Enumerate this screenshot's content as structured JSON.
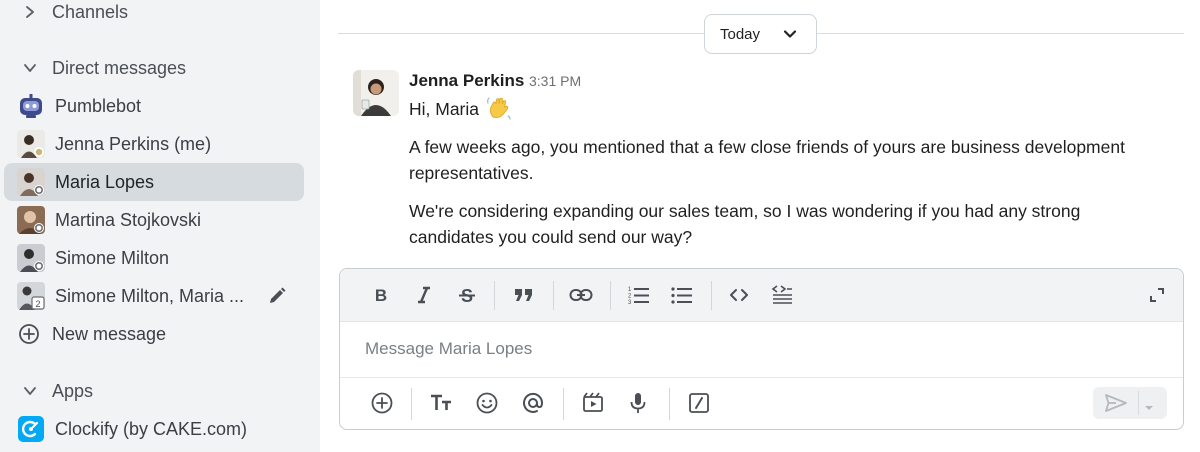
{
  "sidebar": {
    "channels_label": "Channels",
    "dm_label": "Direct messages",
    "dms": [
      {
        "name": "Pumblebot",
        "avatar": "bot-avatar-icon"
      },
      {
        "name": "Jenna Perkins (me)",
        "avatar": "user-avatar"
      },
      {
        "name": "Maria Lopes",
        "avatar": "user-avatar",
        "active": true
      },
      {
        "name": "Martina Stojkovski",
        "avatar": "user-avatar"
      },
      {
        "name": "Simone Milton",
        "avatar": "user-avatar"
      },
      {
        "name": "Simone Milton, Maria ...",
        "avatar": "group-avatar"
      }
    ],
    "new_message_label": "New message",
    "apps_label": "Apps",
    "apps": [
      {
        "name": "Clockify (by CAKE.com)",
        "icon": "clockify-icon"
      }
    ]
  },
  "main": {
    "date_divider": "Today",
    "message": {
      "author": "Jenna Perkins",
      "time": "3:31 PM",
      "greeting": "Hi, Maria",
      "line1a": "A few weeks ago, you mentioned that a few close friends of yours are business development",
      "line1b": "representatives.",
      "line2a": "We're considering expanding our sales team, so I was wondering if you had any strong",
      "line2b": "candidates you could send our way?"
    },
    "composer": {
      "placeholder": "Message Maria Lopes"
    }
  },
  "colors": {
    "sidebar_bg": "#f1f3f5",
    "active_row": "#d6dbe0",
    "clockify_blue": "#03a9f4"
  }
}
